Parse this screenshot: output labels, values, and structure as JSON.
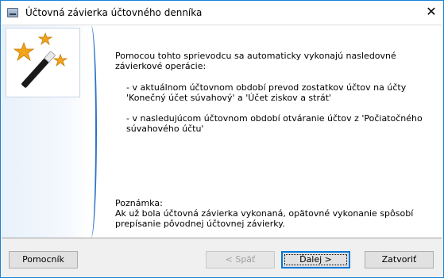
{
  "window": {
    "title": "Účtovná závierka účtovného denníka",
    "close_icon": "close-icon",
    "app_icon": "wizard-app-icon"
  },
  "sidebar": {
    "art": "magic-wand-with-stars",
    "accent_color": "#2a72c8"
  },
  "content": {
    "intro": "Pomocou tohto sprievodcu sa automaticky vykonajú nasledovné\nzávierkové operácie:",
    "bullets": [
      {
        "line1": "- v aktuálnom účtovnom období prevod zostatkov účtov na účty",
        "line2": "'Konečný účet súvahový' a 'Účet ziskov a strát'"
      },
      {
        "line1": "- v nasledujúcom účtovnom období otváranie účtov z 'Počiatočného",
        "line2": "súvahového účtu'"
      }
    ],
    "note_label": "Poznámka:",
    "note_line1": "Ak už bola účtovná závierka vykonaná, opätovné vykonanie spôsobí",
    "note_line2": "prepísanie pôvodnej účtovnej závierky."
  },
  "buttons": {
    "help": "Pomocník",
    "back": "< Späť",
    "next": "Ďalej >",
    "close": "Zatvoriť"
  },
  "colors": {
    "border": "#1883d7",
    "default_button": "#0078d7"
  }
}
